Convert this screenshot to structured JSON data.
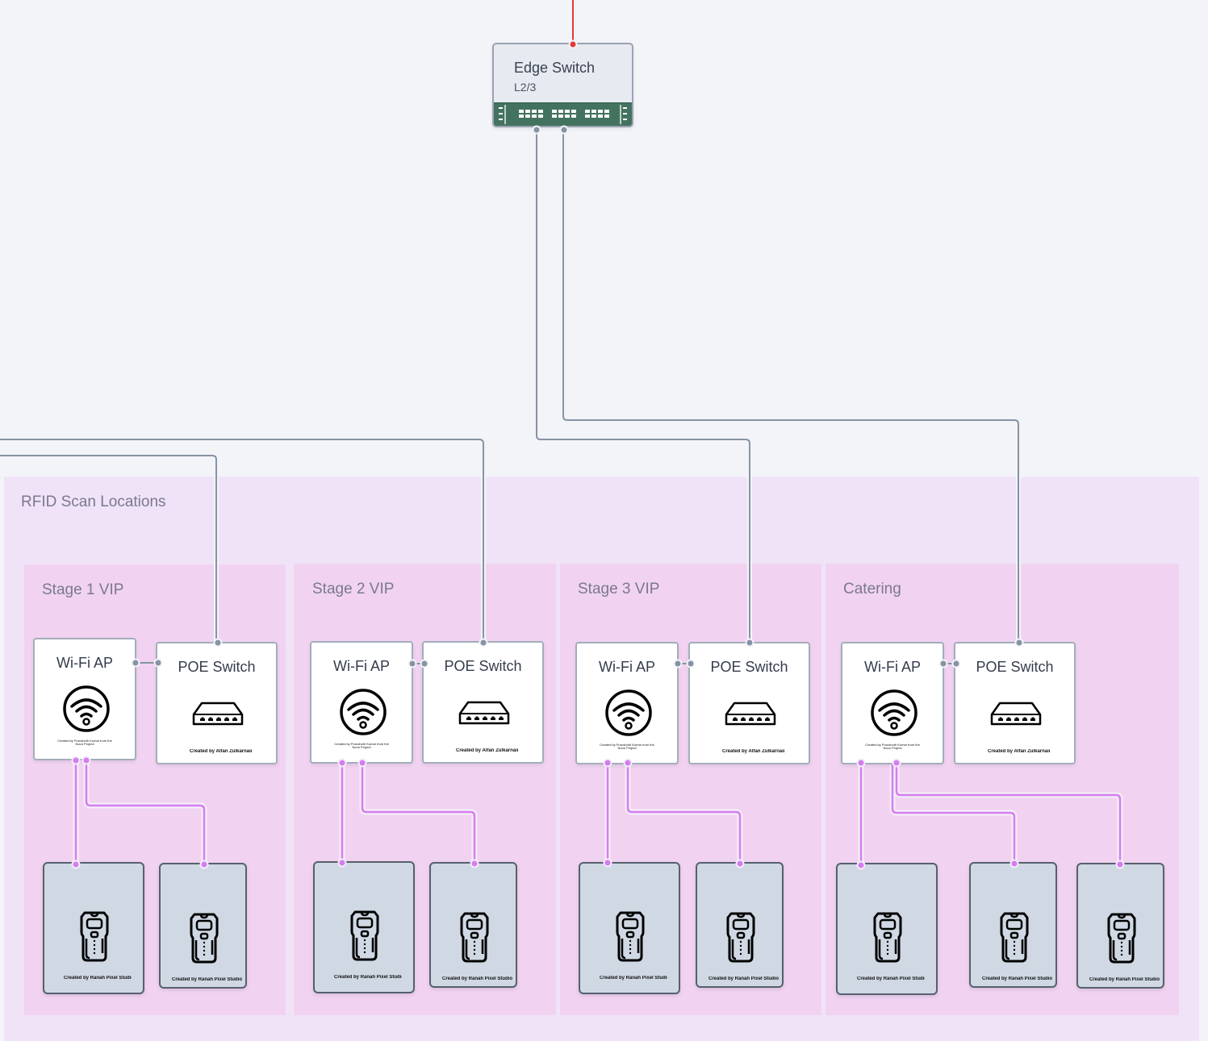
{
  "edge_switch": {
    "title": "Edge Switch",
    "subtitle": "L2/3",
    "icon": "switch-rack-icon",
    "panel_color": "#43735f"
  },
  "group": {
    "label": "RFID Scan Locations",
    "color": "#f0e3f7"
  },
  "colors": {
    "uplink_line": "#8693a4",
    "wifi_line": "#d67cf0",
    "upstream_line": "#e53935",
    "stage_bg": "#f1d3f1",
    "device_bg": "#cfd8e3"
  },
  "stages": [
    {
      "label": "Stage 1 VIP",
      "wifi_ap": {
        "title": "Wi-Fi AP",
        "icon": "wifi-icon",
        "credit": "Created by Purushoth Kumar from the Noun Project"
      },
      "poe_switch": {
        "title": "POE Switch",
        "icon": "network-switch-icon",
        "credit": "Created by Alfan Zulkarnain"
      },
      "scanners": [
        {
          "icon": "rfid-scanner-icon",
          "credit": "Created by Ranah Pixel Studio"
        },
        {
          "icon": "rfid-scanner-icon",
          "credit": "Created by Ranah Pixel Studio"
        }
      ]
    },
    {
      "label": "Stage 2 VIP",
      "wifi_ap": {
        "title": "Wi-Fi AP",
        "icon": "wifi-icon",
        "credit": "Created by Purushoth Kumar from the Noun Project"
      },
      "poe_switch": {
        "title": "POE Switch",
        "icon": "network-switch-icon",
        "credit": "Created by Alfan Zulkarnain"
      },
      "scanners": [
        {
          "icon": "rfid-scanner-icon",
          "credit": "Created by Ranah Pixel Studio"
        },
        {
          "icon": "rfid-scanner-icon",
          "credit": "Created by Ranah Pixel Studio"
        }
      ]
    },
    {
      "label": "Stage 3 VIP",
      "wifi_ap": {
        "title": "Wi-Fi AP",
        "icon": "wifi-icon",
        "credit": "Created by Purushoth Kumar from the Noun Project"
      },
      "poe_switch": {
        "title": "POE Switch",
        "icon": "network-switch-icon",
        "credit": "Created by Alfan Zulkarnain"
      },
      "scanners": [
        {
          "icon": "rfid-scanner-icon",
          "credit": "Created by Ranah Pixel Studio"
        },
        {
          "icon": "rfid-scanner-icon",
          "credit": "Created by Ranah Pixel Studio"
        }
      ]
    },
    {
      "label": "Catering",
      "wifi_ap": {
        "title": "Wi-Fi AP",
        "icon": "wifi-icon",
        "credit": "Created by Purushoth Kumar from the Noun Project"
      },
      "poe_switch": {
        "title": "POE Switch",
        "icon": "network-switch-icon",
        "credit": "Created by Alfan Zulkarnain"
      },
      "scanners": [
        {
          "icon": "rfid-scanner-icon",
          "credit": "Created by Ranah Pixel Studio"
        },
        {
          "icon": "rfid-scanner-icon",
          "credit": "Created by Ranah Pixel Studio"
        },
        {
          "icon": "rfid-scanner-icon",
          "credit": "Created by Ranah Pixel Studio"
        }
      ]
    }
  ]
}
